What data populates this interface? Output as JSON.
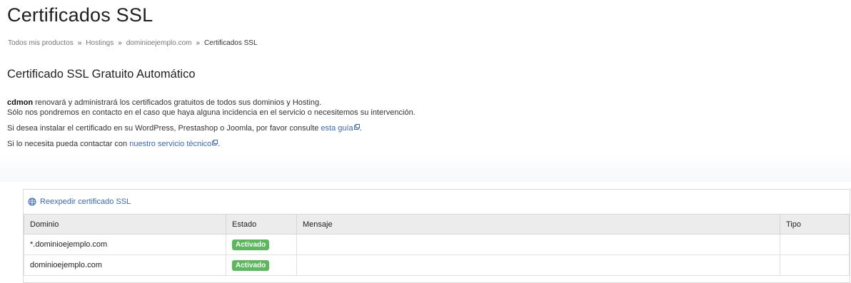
{
  "page": {
    "title": "Certificados SSL"
  },
  "breadcrumb": {
    "items": [
      "Todos mis productos",
      "Hostings",
      "dominioejemplo.com"
    ],
    "separator": "»",
    "current": "Certificados SSL"
  },
  "section": {
    "title": "Certificado SSL Gratuito Automático",
    "brand": "cdmon",
    "line1": " renovará y administrará los certificados gratuitos de todos sus dominios y Hosting.",
    "line2": "Sólo nos pondremos en contacto en el caso que haya alguna incidencia en el servicio o necesitemos su intervención.",
    "line3_prefix": "Si desea instalar el certificado en su WordPress, Prestashop o Joomla, por favor consulte ",
    "line3_link": "esta guía",
    "line3_suffix": ".",
    "line4_prefix": "Si lo necesita pueda contactar con ",
    "line4_link": "nuestro servicio técnico",
    "line4_suffix": "."
  },
  "panel": {
    "action_icon": "globe-icon",
    "action_label": "Reexpedir certificado SSL",
    "columns": [
      "Dominio",
      "Estado",
      "Mensaje",
      "Tipo"
    ],
    "rows": [
      {
        "dominio": "*.dominioejemplo.com",
        "estado": "Activado",
        "mensaje": "",
        "tipo": ""
      },
      {
        "dominio": "dominioejemplo.com",
        "estado": "Activado",
        "mensaje": "",
        "tipo": ""
      }
    ]
  },
  "colors": {
    "link": "#3a67b8",
    "badge": "#5cb85c"
  }
}
